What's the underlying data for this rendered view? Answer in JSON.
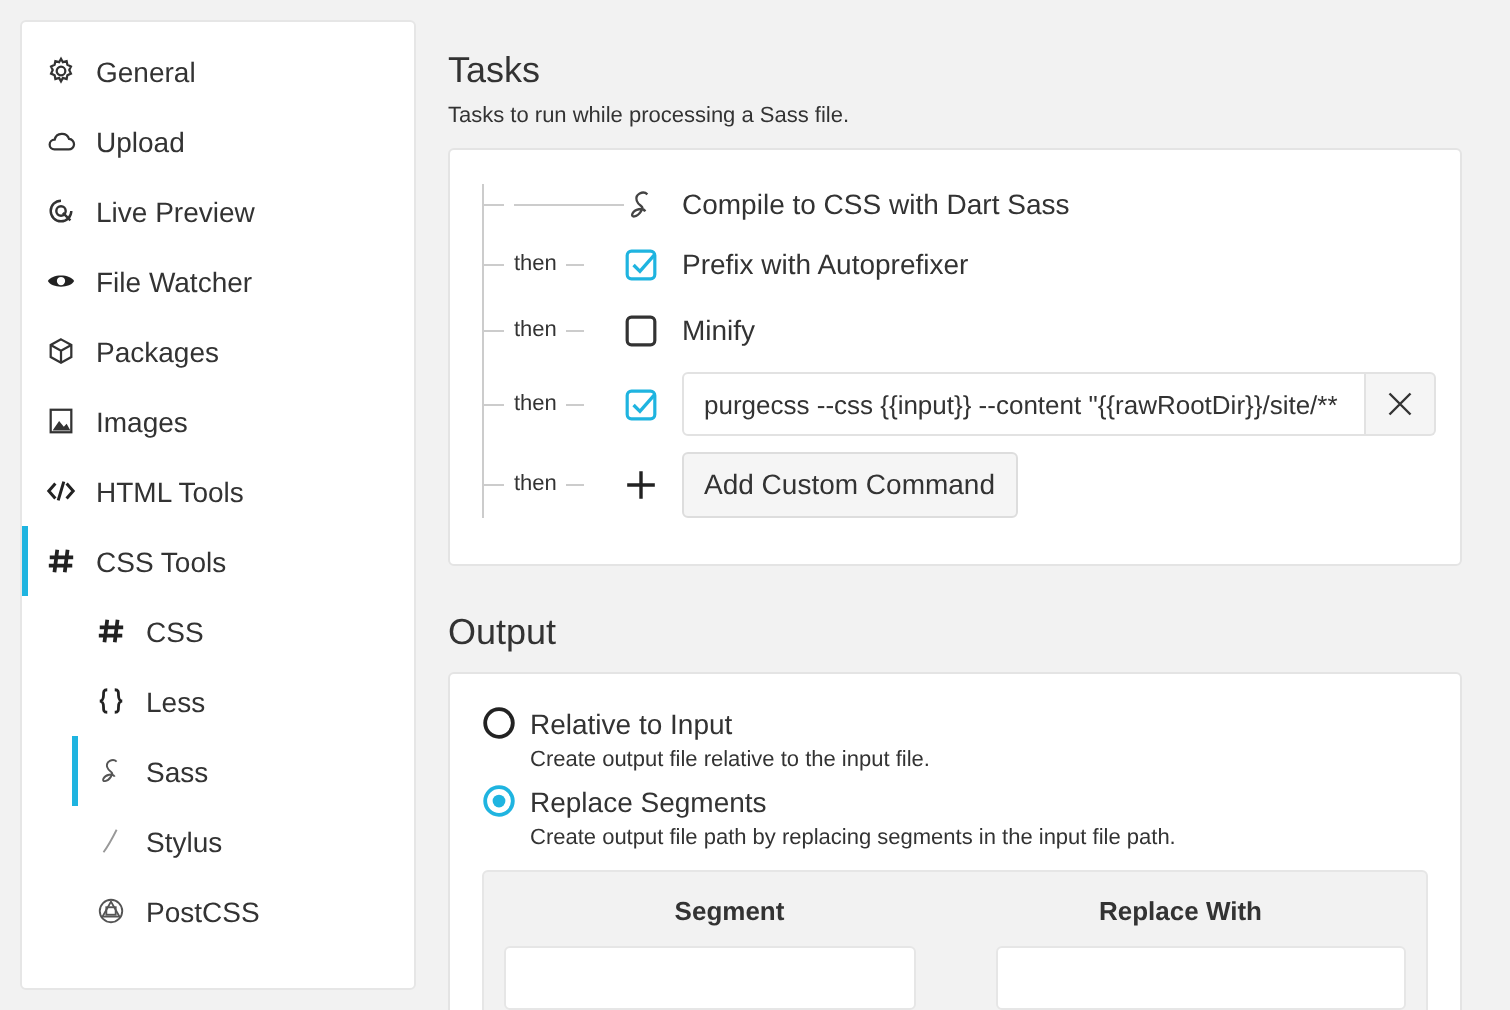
{
  "sidebar": {
    "items": [
      {
        "label": "General",
        "kind": "gear",
        "selected": false
      },
      {
        "label": "Upload",
        "kind": "cloud",
        "selected": false
      },
      {
        "label": "Live Preview",
        "kind": "preview",
        "selected": false
      },
      {
        "label": "File Watcher",
        "kind": "eye",
        "selected": false
      },
      {
        "label": "Packages",
        "kind": "box",
        "selected": false
      },
      {
        "label": "Images",
        "kind": "image",
        "selected": false
      },
      {
        "label": "HTML Tools",
        "kind": "code",
        "selected": false
      },
      {
        "label": "CSS Tools",
        "kind": "hash",
        "selected": true,
        "children": [
          {
            "label": "CSS",
            "kind": "hash",
            "selected": false
          },
          {
            "label": "Less",
            "kind": "braces",
            "selected": false
          },
          {
            "label": "Sass",
            "kind": "sass",
            "selected": true
          },
          {
            "label": "Stylus",
            "kind": "stylus",
            "selected": false
          },
          {
            "label": "PostCSS",
            "kind": "postcss",
            "selected": false
          }
        ]
      }
    ]
  },
  "tasks": {
    "title": "Tasks",
    "subtitle": "Tasks to run while processing a Sass file.",
    "items": [
      {
        "kind": "fixed",
        "label": "Compile to CSS with Dart Sass"
      },
      {
        "kind": "checkbox",
        "connector": "then",
        "label": "Prefix with Autoprefixer",
        "checked": true
      },
      {
        "kind": "checkbox",
        "connector": "then",
        "label": "Minify",
        "checked": false
      },
      {
        "kind": "command",
        "connector": "then",
        "value": "purgecss --css {{input}} --content \"{{rawRootDir}}/site/**",
        "checked": true
      },
      {
        "kind": "add",
        "connector": "then",
        "label": "Add Custom Command"
      }
    ]
  },
  "output": {
    "title": "Output",
    "options": [
      {
        "label": "Relative to Input",
        "description": "Create output file relative to the input file.",
        "selected": false
      },
      {
        "label": "Replace Segments",
        "description": "Create output file path by replacing segments in the input file path.",
        "selected": true
      }
    ],
    "segments": {
      "columns": [
        "Segment",
        "Replace With"
      ]
    }
  }
}
